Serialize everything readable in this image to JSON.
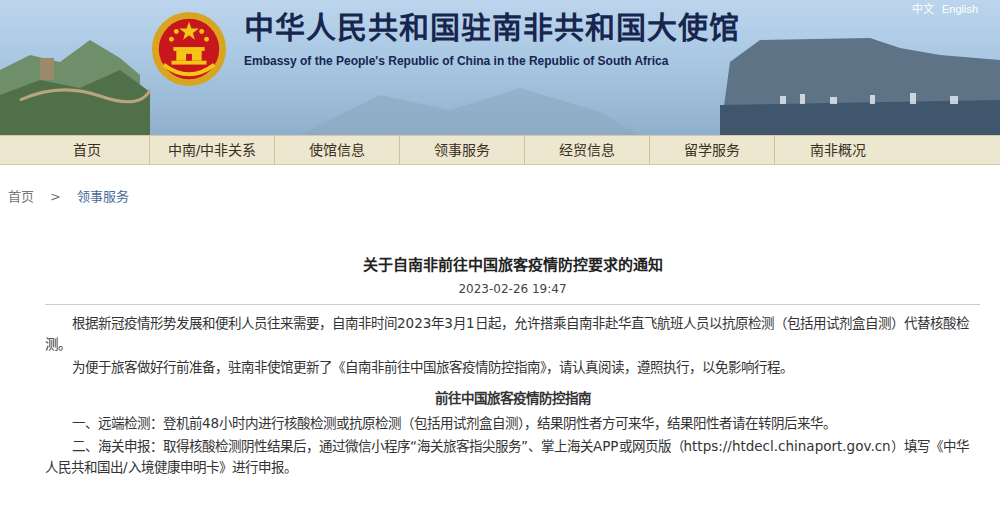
{
  "header": {
    "lang_links": [
      "中文",
      "English"
    ],
    "title": "中华人民共和国驻南非共和国大使馆",
    "subtitle": "Embassy of the People's Republic of China in the Republic of South Africa"
  },
  "nav": [
    {
      "label": "首页",
      "selected": false
    },
    {
      "label": "中南/中非关系",
      "selected": false
    },
    {
      "label": "使馆信息",
      "selected": false
    },
    {
      "label": "领事服务",
      "selected": false
    },
    {
      "label": "经贸信息",
      "selected": false
    },
    {
      "label": "留学服务",
      "selected": false
    },
    {
      "label": "南非概况",
      "selected": false
    }
  ],
  "breadcrumb": {
    "items": [
      "首页",
      "领事服务"
    ],
    "separator": ">"
  },
  "article": {
    "title": "关于自南非前往中国旅客疫情防控要求的通知",
    "date": "2023-02-26 19:47",
    "paragraphs": [
      "根据新冠疫情形势发展和便利人员往来需要，自南非时间2023年3月1日起，允许搭乘自南非赴华直飞航班人员以抗原检测（包括用试剂盒自测）代替核酸检测。",
      "为便于旅客做好行前准备，驻南非使馆更新了《自南非前往中国旅客疫情防控指南》，请认真阅读，遵照执行，以免影响行程。"
    ],
    "guide_heading": "前往中国旅客疫情防控指南",
    "guide_items": [
      "一、远端检测：登机前48小时内进行核酸检测或抗原检测（包括用试剂盒自测），结果阴性者方可来华，结果阳性者请在转阴后来华。",
      "二、海关申报：取得核酸检测阴性结果后，通过微信小程序“海关旅客指尖服务”、掌上海关APP或网页版（https://htdecl.chinaport.gov.cn）填写《中华人民共和国出/入境健康申明卡》进行申报。"
    ]
  }
}
